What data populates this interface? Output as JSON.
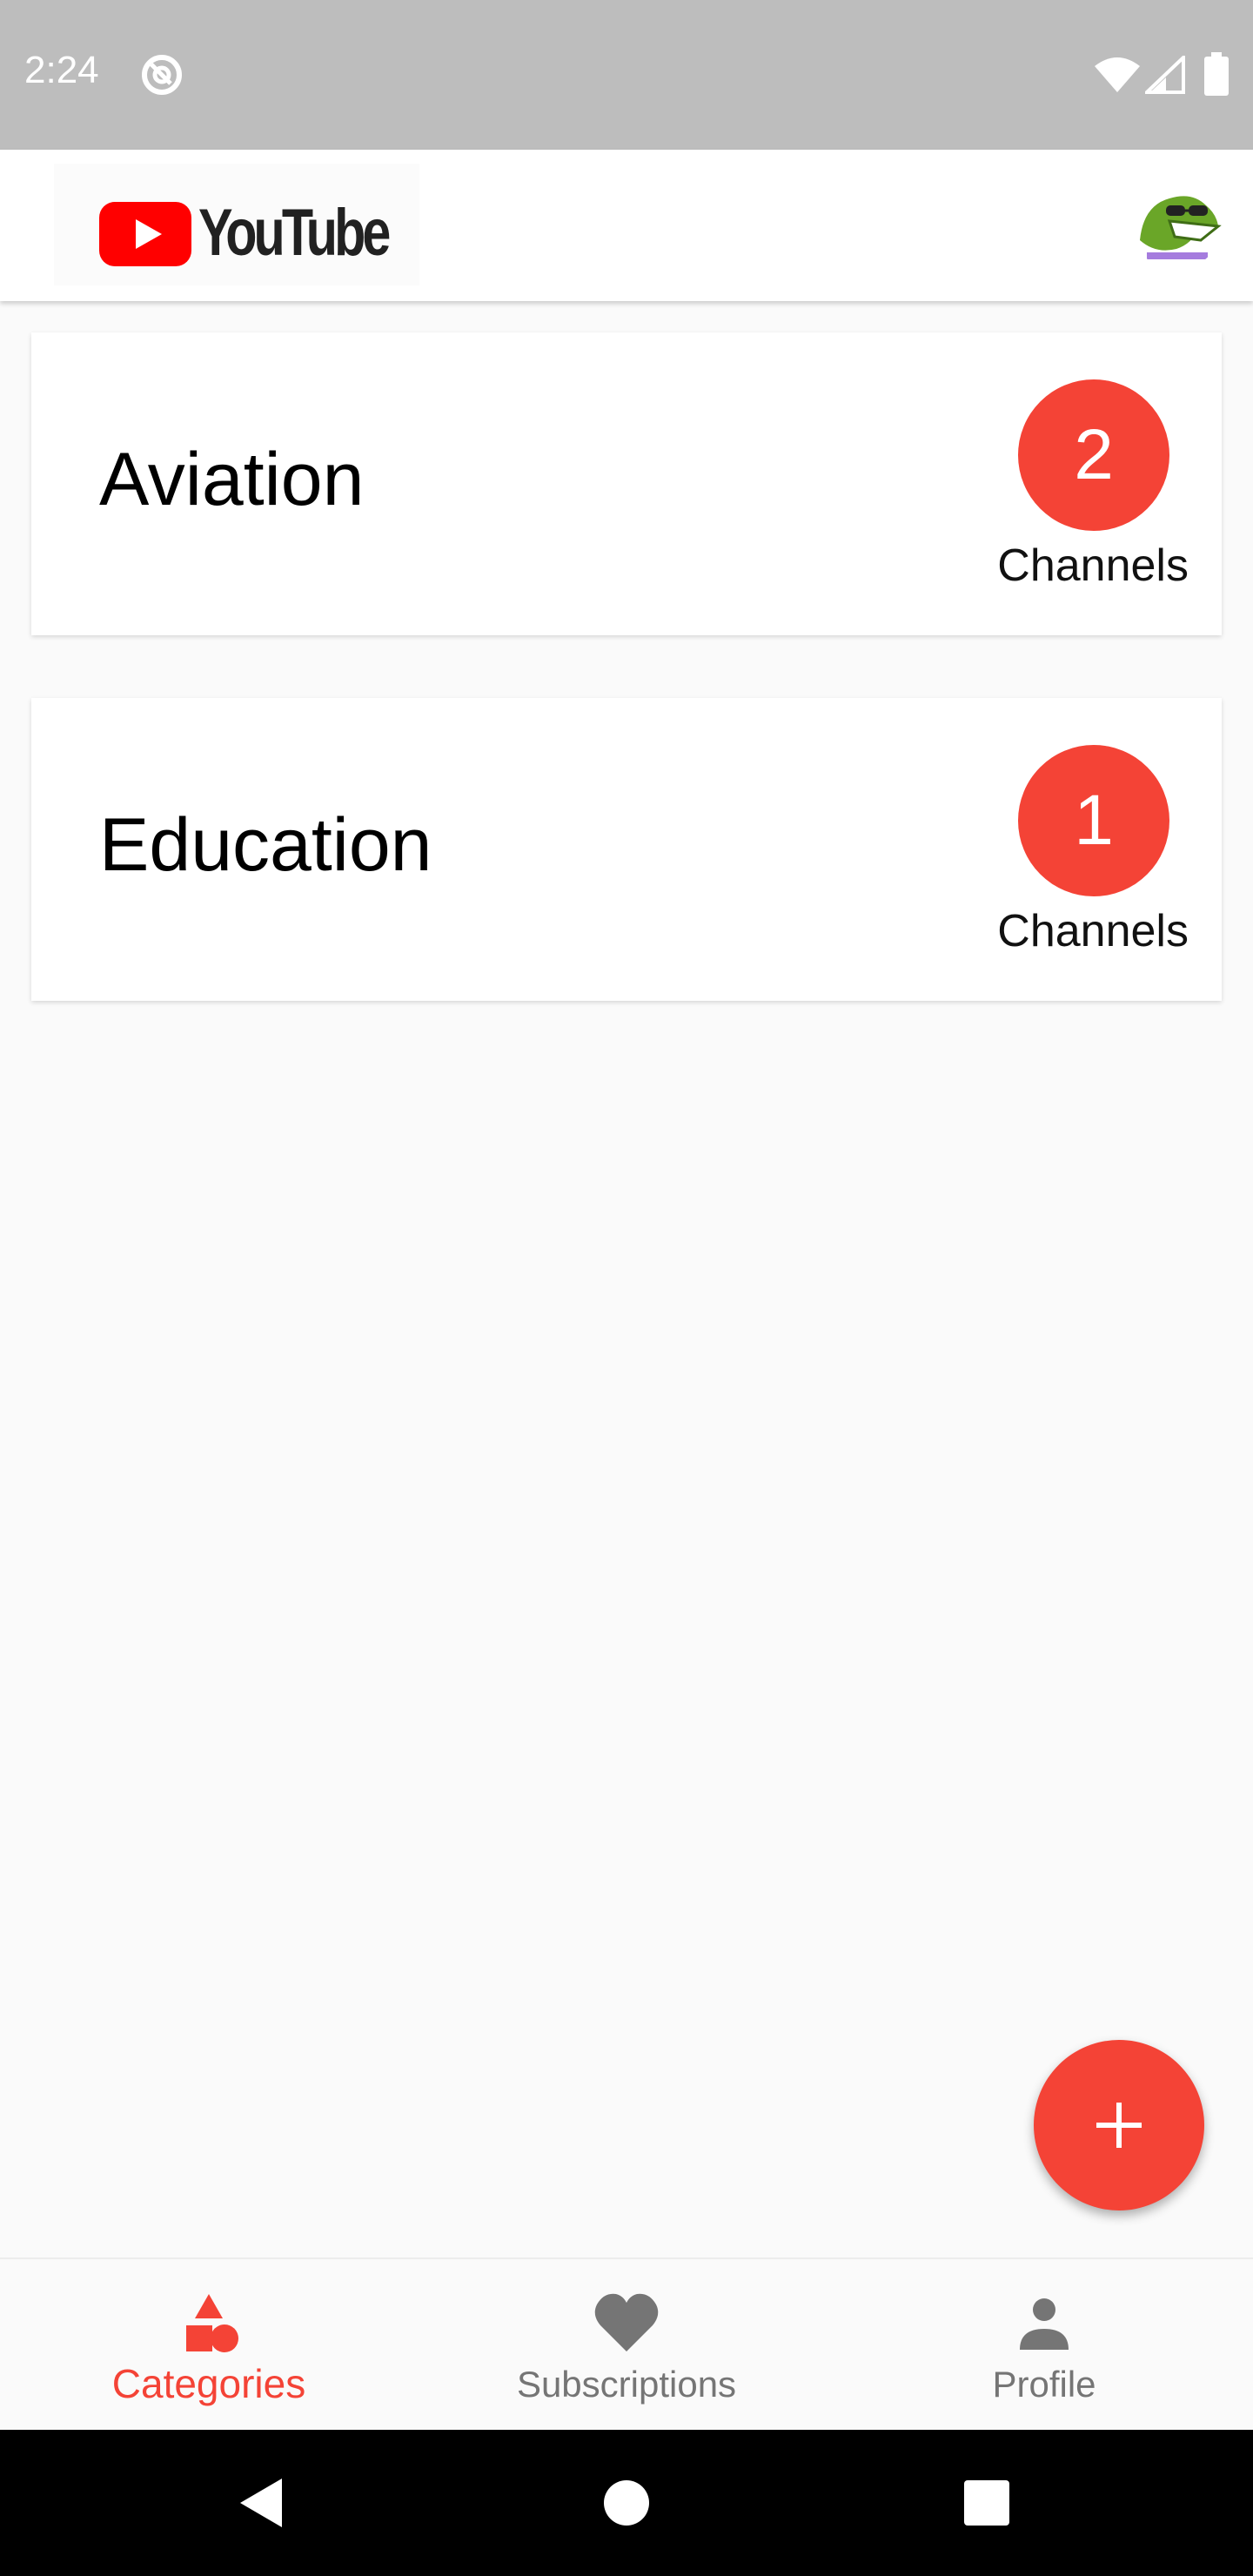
{
  "status_bar": {
    "time": "2:24",
    "app_icon": "notification-app-icon",
    "icons": [
      "wifi-icon",
      "cell-signal-icon",
      "battery-icon"
    ]
  },
  "app_bar": {
    "logo_text": "YouTube",
    "logo_icon": "youtube-play-icon",
    "avatar": "crocodile-avatar"
  },
  "categories": [
    {
      "name": "Aviation",
      "count": "2",
      "count_label": "Channels"
    },
    {
      "name": "Education",
      "count": "1",
      "count_label": "Channels"
    }
  ],
  "fab": {
    "icon": "plus-icon"
  },
  "bottom_nav": {
    "items": [
      {
        "label": "Categories",
        "icon": "shapes-icon",
        "active": true
      },
      {
        "label": "Subscriptions",
        "icon": "heart-icon",
        "active": false
      },
      {
        "label": "Profile",
        "icon": "person-icon",
        "active": false
      }
    ]
  },
  "system_nav": {
    "buttons": [
      "back-icon",
      "home-icon",
      "recents-icon"
    ]
  },
  "colors": {
    "accent": "#f44336",
    "status_bar": "#bdbdbd",
    "inactive": "#757575",
    "background": "#fafafa"
  }
}
